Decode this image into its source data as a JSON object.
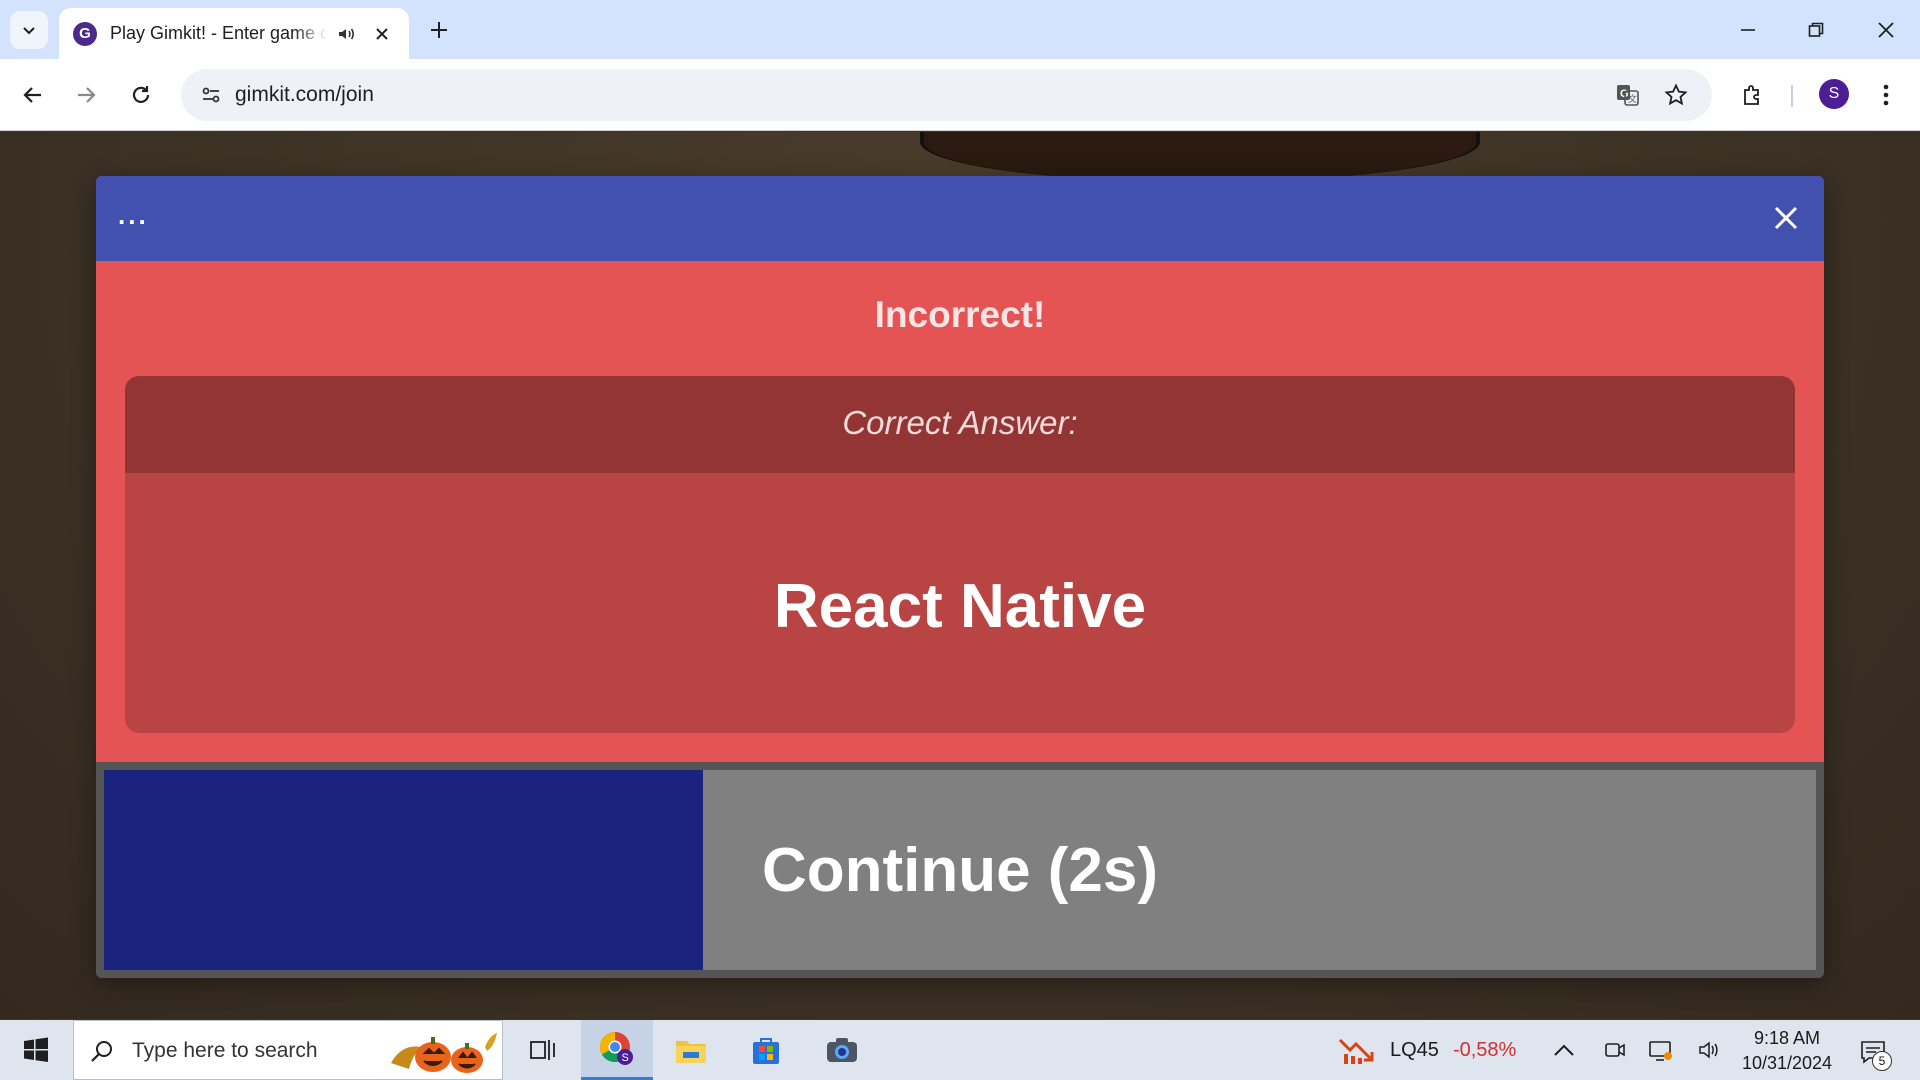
{
  "browser": {
    "tab_title": "Play Gimkit! - Enter game code",
    "url": "gimkit.com/join",
    "profile_initial": "S",
    "favicon_letter": "G"
  },
  "modal": {
    "menu_dots": "...",
    "result_title": "Incorrect!",
    "correct_answer_label": "Correct Answer:",
    "correct_answer": "React Native",
    "continue_label": "Continue (2s)",
    "continue_progress_percent": 35,
    "colors": {
      "header": "#4251b0",
      "incorrect_bg": "#e45454",
      "progress": "#1a237e"
    }
  },
  "taskbar": {
    "search_placeholder": "Type here to search",
    "stock_name": "LQ45",
    "stock_change": "-0,58%",
    "time": "9:18 AM",
    "date": "10/31/2024",
    "notification_count": "5",
    "apps": [
      "task-view-icon",
      "chrome-icon",
      "file-explorer-icon",
      "microsoft-store-icon",
      "camera-icon"
    ]
  }
}
